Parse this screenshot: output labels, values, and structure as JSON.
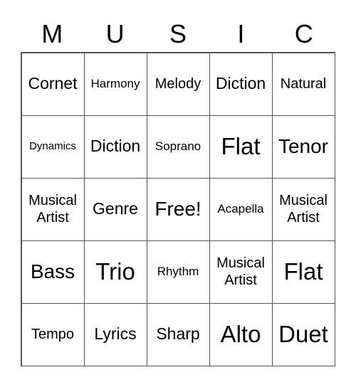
{
  "header": [
    "M",
    "U",
    "S",
    "I",
    "C"
  ],
  "cells": [
    [
      "Cornet",
      "Harmony",
      "Melody",
      "Diction",
      "Natural"
    ],
    [
      "Dynamics",
      "Diction",
      "Soprano",
      "Flat",
      "Tenor"
    ],
    [
      "Musical Artist",
      "Genre",
      "Free!",
      "Acapella",
      "Musical Artist"
    ],
    [
      "Bass",
      "Trio",
      "Rhythm",
      "Musical Artist",
      "Flat"
    ],
    [
      "Tempo",
      "Lyrics",
      "Sharp",
      "Alto",
      "Duet"
    ]
  ]
}
